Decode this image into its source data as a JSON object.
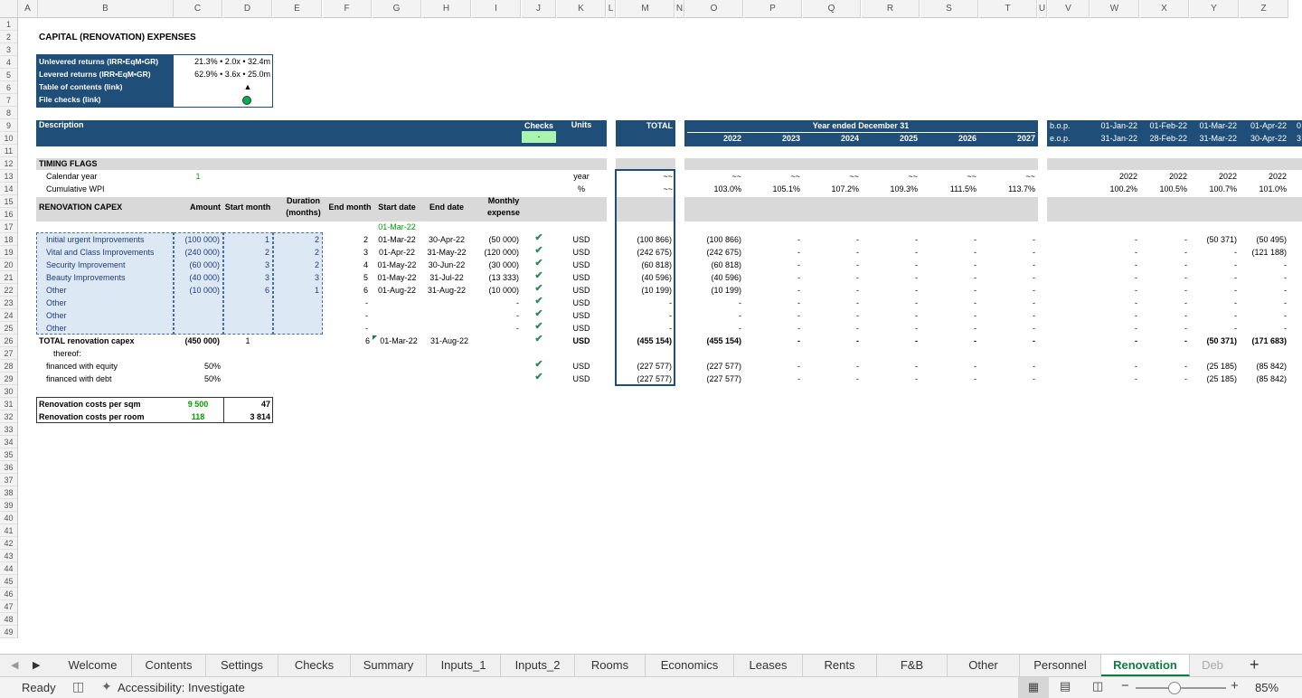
{
  "columns": [
    "A",
    "B",
    "C",
    "D",
    "E",
    "F",
    "G",
    "H",
    "I",
    "J",
    "K",
    "L",
    "M",
    "N",
    "O",
    "P",
    "Q",
    "R",
    "S",
    "T",
    "U",
    "V",
    "W",
    "X",
    "Y",
    "Z"
  ],
  "rows": [
    "1",
    "2",
    "3",
    "4",
    "5",
    "6",
    "7",
    "8",
    "9",
    "10",
    "11",
    "12",
    "13",
    "14",
    "15",
    "16",
    "17",
    "18",
    "19",
    "20",
    "21",
    "22",
    "23",
    "24",
    "25",
    "26",
    "27",
    "28",
    "29",
    "30",
    "31",
    "32",
    "33",
    "34",
    "35",
    "36",
    "37",
    "38",
    "39",
    "40",
    "41",
    "42",
    "43",
    "44",
    "45",
    "46",
    "47",
    "48",
    "49"
  ],
  "title": "CAPITAL (RENOVATION) EXPENSES",
  "summary": [
    {
      "label": "Unlevered returns (IRR•EqM•GR)",
      "value": "21.3% • 2.0x • 32.4m"
    },
    {
      "label": "Levered returns (IRR•EqM•GR)",
      "value": "62.9% • 3.6x • 25.0m"
    },
    {
      "label": "Table of contents (link)",
      "value": "▲"
    },
    {
      "label": "File checks (link)",
      "value": ""
    }
  ],
  "header": {
    "description": "Description",
    "checks": "Checks",
    "checks_value": "-",
    "units": "Units",
    "total": "TOTAL",
    "year_ended": "Year ended December 31",
    "years": [
      "2022",
      "2023",
      "2024",
      "2025",
      "2026",
      "2027"
    ],
    "bop": "b.o.p.",
    "eop": "e.o.p.",
    "month_starts": [
      "01-Jan-22",
      "01-Feb-22",
      "01-Mar-22",
      "01-Apr-22"
    ],
    "month_ends": [
      "31-Jan-22",
      "28-Feb-22",
      "31-Mar-22",
      "30-Apr-22"
    ],
    "month_start_partial": "0",
    "month_end_partial": "3"
  },
  "timing": {
    "section": "TIMING FLAGS",
    "calendar_label": "Calendar year",
    "calendar_value": "1",
    "calendar_unit": "year",
    "calendar_total": "~~",
    "calendar_years": [
      "~~",
      "~~",
      "~~",
      "~~",
      "~~",
      "~~"
    ],
    "calendar_months": [
      "2022",
      "2022",
      "2022",
      "2022"
    ],
    "wpi_label": "Cumulative WPI",
    "wpi_unit": "%",
    "wpi_total": "~~",
    "wpi_years": [
      "103.0%",
      "105.1%",
      "107.2%",
      "109.3%",
      "111.5%",
      "113.7%"
    ],
    "wpi_months": [
      "100.2%",
      "100.5%",
      "100.7%",
      "101.0%"
    ]
  },
  "capex_header": {
    "section": "RENOVATION CAPEX",
    "amount": "Amount",
    "start_month": "Start month",
    "duration_1": "Duration",
    "duration_2": "(months)",
    "end_month": "End month",
    "start_date": "Start date",
    "end_date": "End date",
    "monthly_1": "Monthly",
    "monthly_2": "expense",
    "first_date": "01-Mar-22"
  },
  "capex_rows": [
    {
      "name": "Initial urgent Improvements",
      "amount": "(100 000)",
      "start": "1",
      "duration": "2",
      "end": "2",
      "sdate": "01-Mar-22",
      "edate": "30-Apr-22",
      "monthly": "(50 000)",
      "check": "✔",
      "unit": "USD",
      "total": "(100 866)",
      "years": [
        "(100 866)",
        "-",
        "-",
        "-",
        "-",
        "-"
      ],
      "months": [
        "-",
        "-",
        "(50 371)",
        "(50 495)"
      ]
    },
    {
      "name": "Vital and Class Improvements",
      "amount": "(240 000)",
      "start": "2",
      "duration": "2",
      "end": "3",
      "sdate": "01-Apr-22",
      "edate": "31-May-22",
      "monthly": "(120 000)",
      "check": "✔",
      "unit": "USD",
      "total": "(242 675)",
      "years": [
        "(242 675)",
        "-",
        "-",
        "-",
        "-",
        "-"
      ],
      "months": [
        "-",
        "-",
        "-",
        "(121 188)"
      ]
    },
    {
      "name": "Security Improvement",
      "amount": "(60 000)",
      "start": "3",
      "duration": "2",
      "end": "4",
      "sdate": "01-May-22",
      "edate": "30-Jun-22",
      "monthly": "(30 000)",
      "check": "✔",
      "unit": "USD",
      "total": "(60 818)",
      "years": [
        "(60 818)",
        "-",
        "-",
        "-",
        "-",
        "-"
      ],
      "months": [
        "-",
        "-",
        "-",
        "-"
      ]
    },
    {
      "name": "Beauty Improvements",
      "amount": "(40 000)",
      "start": "3",
      "duration": "3",
      "end": "5",
      "sdate": "01-May-22",
      "edate": "31-Jul-22",
      "monthly": "(13 333)",
      "check": "✔",
      "unit": "USD",
      "total": "(40 596)",
      "years": [
        "(40 596)",
        "-",
        "-",
        "-",
        "-",
        "-"
      ],
      "months": [
        "-",
        "-",
        "-",
        "-"
      ]
    },
    {
      "name": "Other",
      "amount": "(10 000)",
      "start": "6",
      "duration": "1",
      "end": "6",
      "sdate": "01-Aug-22",
      "edate": "31-Aug-22",
      "monthly": "(10 000)",
      "check": "✔",
      "unit": "USD",
      "total": "(10 199)",
      "years": [
        "(10 199)",
        "-",
        "-",
        "-",
        "-",
        "-"
      ],
      "months": [
        "-",
        "-",
        "-",
        "-"
      ]
    },
    {
      "name": "Other",
      "amount": "",
      "start": "",
      "duration": "",
      "end": "-",
      "sdate": "",
      "edate": "",
      "monthly": "-",
      "check": "✔",
      "unit": "USD",
      "total": "-",
      "years": [
        "-",
        "-",
        "-",
        "-",
        "-",
        "-"
      ],
      "months": [
        "-",
        "-",
        "-",
        "-"
      ]
    },
    {
      "name": "Other",
      "amount": "",
      "start": "",
      "duration": "",
      "end": "-",
      "sdate": "",
      "edate": "",
      "monthly": "-",
      "check": "✔",
      "unit": "USD",
      "total": "-",
      "years": [
        "-",
        "-",
        "-",
        "-",
        "-",
        "-"
      ],
      "months": [
        "-",
        "-",
        "-",
        "-"
      ]
    },
    {
      "name": "Other",
      "amount": "",
      "start": "",
      "duration": "",
      "end": "-",
      "sdate": "",
      "edate": "",
      "monthly": "-",
      "check": "✔",
      "unit": "USD",
      "total": "-",
      "years": [
        "-",
        "-",
        "-",
        "-",
        "-",
        "-"
      ],
      "months": [
        "-",
        "-",
        "-",
        "-"
      ]
    }
  ],
  "total_row": {
    "name": "TOTAL renovation capex",
    "amount": "(450 000)",
    "start": "1",
    "end": "6",
    "sdate": "01-Mar-22",
    "edate": "31-Aug-22",
    "check": "✔",
    "unit": "USD",
    "total": "(455 154)",
    "years": [
      "(455 154)",
      "-",
      "-",
      "-",
      "-",
      "-"
    ],
    "months": [
      "-",
      "-",
      "(50 371)",
      "(171 683)"
    ]
  },
  "thereof": "thereof:",
  "financing": [
    {
      "name": "financed with equity",
      "pct": "50%",
      "check": "✔",
      "unit": "USD",
      "total": "(227 577)",
      "years": [
        "(227 577)",
        "-",
        "-",
        "-",
        "-",
        "-"
      ],
      "months": [
        "-",
        "-",
        "(25 185)",
        "(85 842)"
      ]
    },
    {
      "name": "financed with debt",
      "pct": "50%",
      "check": "✔",
      "unit": "USD",
      "total": "(227 577)",
      "years": [
        "(227 577)",
        "-",
        "-",
        "-",
        "-",
        "-"
      ],
      "months": [
        "-",
        "-",
        "(25 185)",
        "(85 842)"
      ]
    }
  ],
  "costs": [
    {
      "label": "Renovation costs per sqm",
      "input": "9 500",
      "value": "47"
    },
    {
      "label": "Renovation costs per room",
      "input": "118",
      "value": "3 814"
    }
  ],
  "tabs": [
    "Welcome",
    "Contents",
    "Settings",
    "Checks",
    "Summary",
    "Inputs_1",
    "Inputs_2",
    "Rooms",
    "Economics",
    "Leases",
    "Rents",
    "F&B",
    "Other",
    "Personnel",
    "Renovation",
    "Deb"
  ],
  "active_tab": "Renovation",
  "status": {
    "ready": "Ready",
    "accessibility": "Accessibility: Investigate",
    "zoom": "85%",
    "add": "+"
  },
  "colors": {
    "navy": "#1f4e79",
    "input_fill": "#dde8f5",
    "check_green": "#2e8b57",
    "excel_green": "#107c41",
    "dot_green": "#00b050"
  }
}
